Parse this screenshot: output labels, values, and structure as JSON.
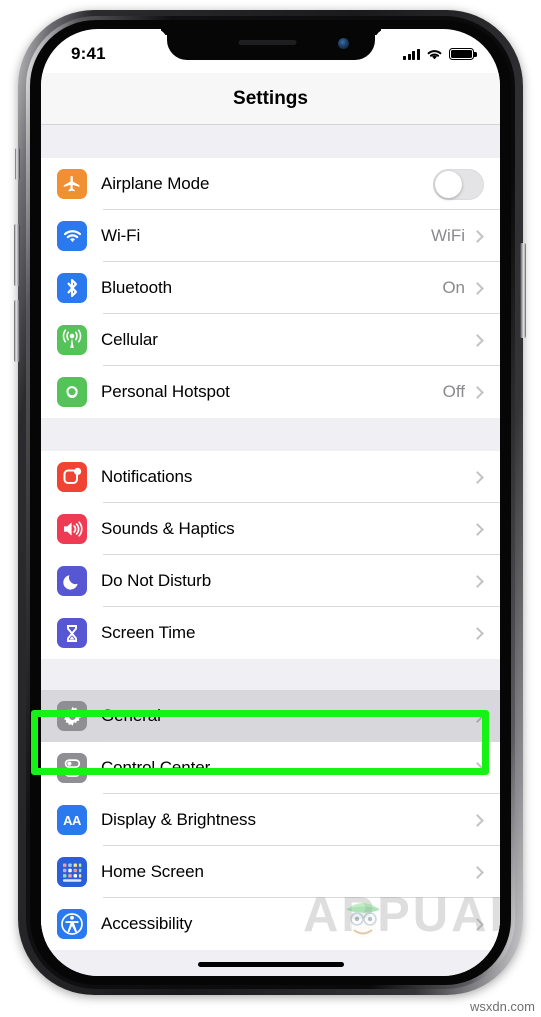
{
  "status_bar": {
    "time": "9:41",
    "signal_icon": "cellular-bars-icon",
    "wifi_icon": "wifi-icon",
    "battery_icon": "battery-full-icon"
  },
  "nav": {
    "title": "Settings"
  },
  "groups": [
    {
      "id": "connectivity",
      "rows": [
        {
          "label": "Airplane Mode",
          "value": "",
          "icon": "airplane-icon",
          "accessory": "toggle",
          "toggle_on": false,
          "color": "#f09033"
        },
        {
          "label": "Wi-Fi",
          "value": "WiFi",
          "icon": "wifi-icon",
          "accessory": "chevron",
          "color": "#2b79ef"
        },
        {
          "label": "Bluetooth",
          "value": "On",
          "icon": "bluetooth-icon",
          "accessory": "chevron",
          "color": "#2b79ef"
        },
        {
          "label": "Cellular",
          "value": "",
          "icon": "cellular-antenna-icon",
          "accessory": "chevron",
          "color": "#56c25a"
        },
        {
          "label": "Personal Hotspot",
          "value": "Off",
          "icon": "hotspot-link-icon",
          "accessory": "chevron",
          "color": "#56c25a"
        }
      ]
    },
    {
      "id": "alerts",
      "rows": [
        {
          "label": "Notifications",
          "value": "",
          "icon": "notifications-badge-icon",
          "accessory": "chevron",
          "color": "#ef4434"
        },
        {
          "label": "Sounds & Haptics",
          "value": "",
          "icon": "speaker-waves-icon",
          "accessory": "chevron",
          "color": "#ee3b53"
        },
        {
          "label": "Do Not Disturb",
          "value": "",
          "icon": "moon-icon",
          "accessory": "chevron",
          "color": "#5757d4"
        },
        {
          "label": "Screen Time",
          "value": "",
          "icon": "hourglass-icon",
          "accessory": "chevron",
          "color": "#5757d4"
        }
      ]
    },
    {
      "id": "system",
      "rows": [
        {
          "label": "General",
          "value": "",
          "icon": "gear-icon",
          "accessory": "chevron",
          "color": "#8e8e93",
          "selected": true
        },
        {
          "label": "Control Center",
          "value": "",
          "icon": "control-center-toggles-icon",
          "accessory": "chevron",
          "color": "#8e8e93"
        },
        {
          "label": "Display & Brightness",
          "value": "",
          "icon": "display-aa-icon",
          "accessory": "chevron",
          "color": "#2b79ef"
        },
        {
          "label": "Home Screen",
          "value": "",
          "icon": "home-screen-grid-icon",
          "accessory": "chevron",
          "color": "#2b5fd9"
        },
        {
          "label": "Accessibility",
          "value": "",
          "icon": "accessibility-person-icon",
          "accessory": "chevron",
          "color": "#2b79ef"
        }
      ]
    }
  ],
  "annotation": {
    "highlight_color": "#16f116",
    "highlight_target": "General"
  },
  "watermarks": {
    "brand": "APPUALS",
    "url": "wsxdn.com"
  }
}
